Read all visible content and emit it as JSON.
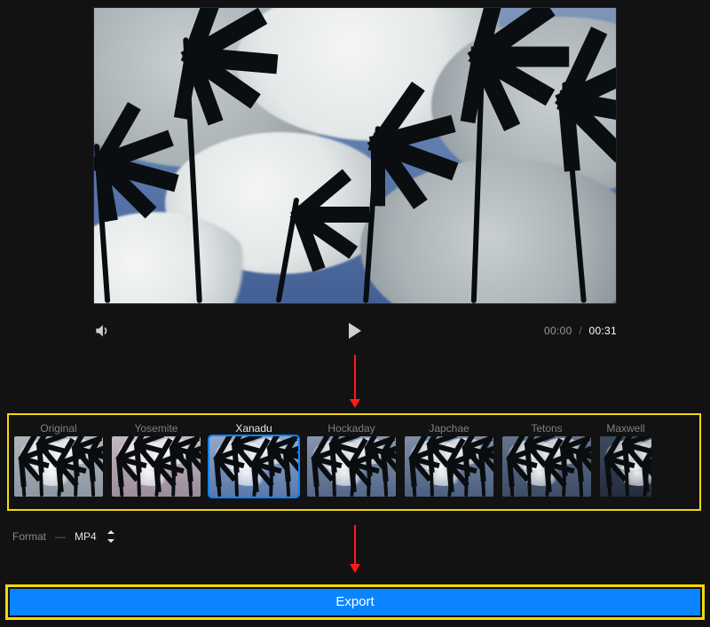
{
  "player": {
    "current_time": "00:00",
    "duration": "00:31",
    "separator": "/",
    "icons": {
      "volume": "volume-icon",
      "play": "play-icon"
    }
  },
  "filters": {
    "items": [
      {
        "label": "Original",
        "key": "original",
        "active": false
      },
      {
        "label": "Yosemite",
        "key": "yosemite",
        "active": false
      },
      {
        "label": "Xanadu",
        "key": "xanadu",
        "active": true
      },
      {
        "label": "Hockaday",
        "key": "hockaday",
        "active": false
      },
      {
        "label": "Japchae",
        "key": "japchae",
        "active": false
      },
      {
        "label": "Tetons",
        "key": "tetons",
        "active": false
      },
      {
        "label": "Maxwell",
        "key": "maxwell",
        "active": false
      }
    ]
  },
  "format": {
    "label": "Format",
    "dash": "—",
    "value": "MP4"
  },
  "export": {
    "label": "Export"
  },
  "colors": {
    "annotation_yellow": "#f5d90a",
    "annotation_red": "#ff1a1a",
    "accent_blue": "#0a84ff"
  }
}
